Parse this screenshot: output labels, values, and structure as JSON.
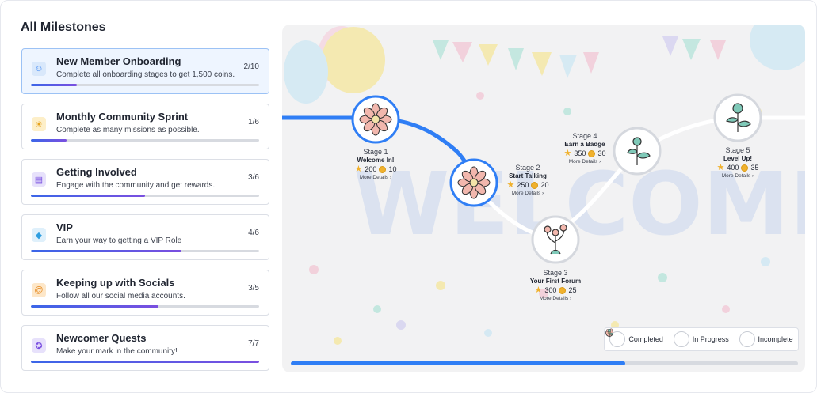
{
  "title": "All Milestones",
  "milestones": [
    {
      "name": "New Member Onboarding",
      "desc": "Complete all onboarding stages to get 1,500 coins.",
      "count": "2/10",
      "progress": 0.2,
      "icon": "smiley-icon"
    },
    {
      "name": "Monthly Community Sprint",
      "desc": "Complete as many missions as possible.",
      "count": "1/6",
      "progress": 0.155,
      "icon": "sun-icon"
    },
    {
      "name": "Getting Involved",
      "desc": "Engage with the community and get rewards.",
      "count": "3/6",
      "progress": 0.5,
      "icon": "chat-icon"
    },
    {
      "name": "VIP",
      "desc": "Earn your way to getting a VIP Role",
      "count": "4/6",
      "progress": 0.66,
      "icon": "diamond-icon"
    },
    {
      "name": "Keeping up with Socials",
      "desc": "Follow all our social media accounts.",
      "count": "3/5",
      "progress": 0.56,
      "icon": "at-icon"
    },
    {
      "name": "Newcomer Quests",
      "desc": "Make your mark in the community!",
      "count": "7/7",
      "progress": 1.0,
      "icon": "ribbon-icon"
    }
  ],
  "stages": [
    {
      "stage": "Stage 1",
      "title": "Welcome In!",
      "stars": "200",
      "coins": "10",
      "details": "More Details",
      "status": "completed"
    },
    {
      "stage": "Stage 2",
      "title": "Start Talking",
      "stars": "250",
      "coins": "20",
      "details": "More Details",
      "status": "completed"
    },
    {
      "stage": "Stage 3",
      "title": "Your First Forum",
      "stars": "300",
      "coins": "25",
      "details": "More Details",
      "status": "in-progress"
    },
    {
      "stage": "Stage 4",
      "title": "Earn a Badge",
      "stars": "350",
      "coins": "30",
      "details": "More Details",
      "status": "incomplete"
    },
    {
      "stage": "Stage 5",
      "title": "Level Up!",
      "stars": "400",
      "coins": "35",
      "details": "More Details",
      "status": "incomplete"
    }
  ],
  "legend": {
    "completed": "Completed",
    "in_progress": "In Progress",
    "incomplete": "Incomplete"
  },
  "map_progress": 0.66,
  "colors": {
    "path_done": "#2f7ef5",
    "path_todo": "#ffffff",
    "accent": "#3b66e8"
  }
}
